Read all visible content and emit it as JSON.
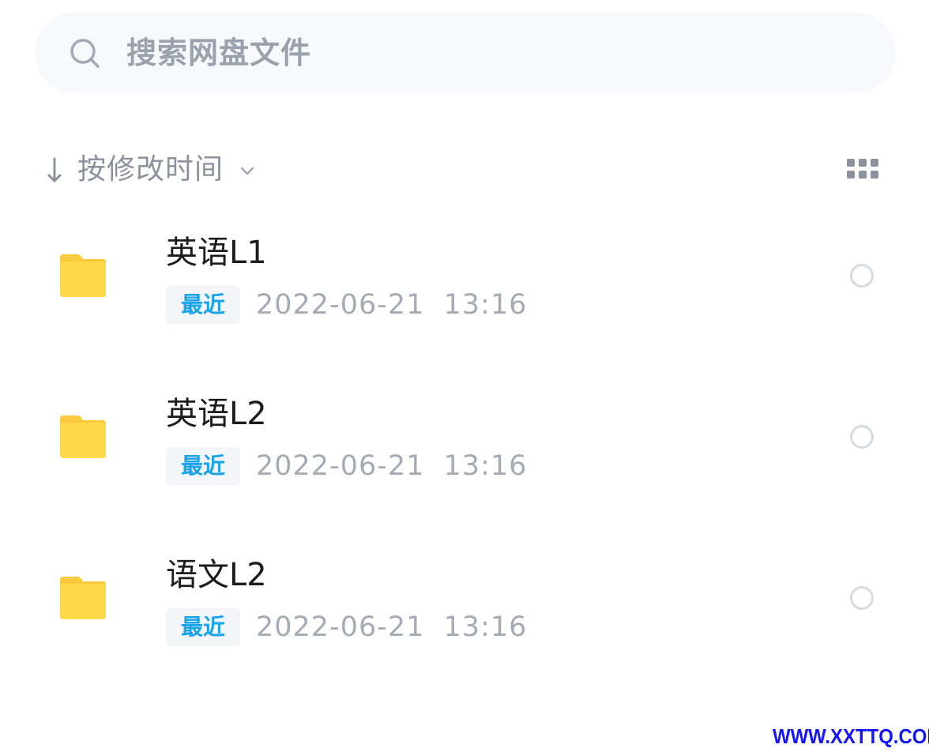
{
  "search": {
    "placeholder": "搜索网盘文件",
    "icon": "search-icon"
  },
  "sort": {
    "label": "按修改时间",
    "direction_icon": "arrow-down-icon",
    "dropdown_icon": "chevron-down-icon"
  },
  "view_toggle": {
    "icon": "grid-view-icon"
  },
  "files": [
    {
      "name": "英语L1",
      "badge": "最近",
      "date": "2022-06-21 13:16",
      "icon": "folder-icon",
      "selected": false
    },
    {
      "name": "英语L2",
      "badge": "最近",
      "date": "2022-06-21 13:16",
      "icon": "folder-icon",
      "selected": false
    },
    {
      "name": "语文L2",
      "badge": "最近",
      "date": "2022-06-21 13:16",
      "icon": "folder-icon",
      "selected": false
    }
  ],
  "watermark": "WWW.XXTTQ.COM",
  "colors": {
    "folder": "#ffd94a",
    "folder_tab": "#fbc93d",
    "badge_text": "#1aa3e8",
    "watermark": "#1414ff"
  }
}
